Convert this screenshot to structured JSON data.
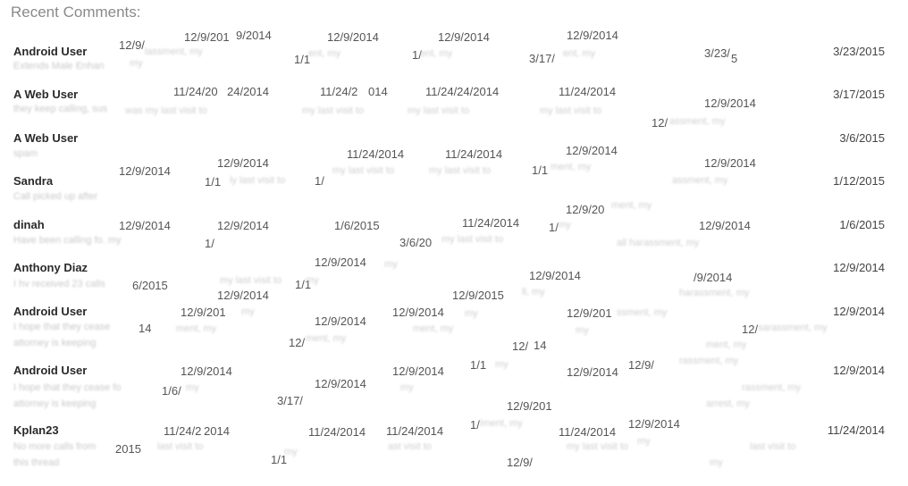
{
  "header": {
    "title": "Recent Comments:"
  },
  "comments": [
    {
      "author": "Android User",
      "preview": "Extends Male Enhan",
      "date": "3/23/2015"
    },
    {
      "author": "A Web User",
      "preview": "they keep calling, sus",
      "date": "3/17/2015"
    },
    {
      "author": "A Web User",
      "preview": "spam",
      "date": "3/6/2015"
    },
    {
      "author": "Sandra",
      "preview": "Call picked up after",
      "date": "1/12/2015"
    },
    {
      "author": "dinah",
      "preview": "Have been calling fo. my",
      "date": "1/6/2015"
    },
    {
      "author": "Anthony Diaz",
      "preview": "I hv received 23 calls",
      "date": "12/9/2014"
    },
    {
      "author": "Android User",
      "preview": "I hope that they cease",
      "preview2": "attorney is keeping",
      "date": "12/9/2014"
    },
    {
      "author": "Android User",
      "preview": "I hope that they cease fo",
      "preview2": "attorney is keeping",
      "date": "12/9/2014"
    },
    {
      "author": "Kplan23",
      "preview": "No more calls from",
      "preview2": "this thread",
      "date": "11/24/2014"
    }
  ],
  "ghosts": [
    "12/9/",
    "12/9/201",
    "9/2014",
    "12/9/2014",
    "12/9/2014",
    "12/9/2014",
    "3/23/",
    "5",
    "1/1",
    "1/",
    "3/17/",
    "11/24/20",
    "24/2014",
    "11/24/2",
    "014",
    "11/24/24/2014",
    "11/24/2014",
    "12/9/2014",
    "12/",
    "11/24/2014",
    "11/24/2014",
    "12/9/2014",
    "12/9/2014",
    "12/9/2014",
    "1/1",
    "1/",
    "1/1",
    "12/9/2014",
    "12/9/20",
    "12/9/2014",
    "12/9/2014",
    "1/6/2015",
    "11/24/2014",
    "1/",
    "12/9/2014",
    "1/",
    "3/6/20",
    "12/9/2014",
    "6/2015",
    "1/1",
    "12/9/2014",
    "/9/2014",
    "12/9/2014",
    "12/9/2015",
    "12/9/201",
    "12/9/2014",
    "12/9/2014",
    "12/9/201",
    "14",
    "12/",
    "12/",
    "12/",
    "14",
    "12/9/2014",
    "12/9/2014",
    "1/1",
    "12/9/2014",
    "12/9/",
    "1/6/",
    "12/9/2014",
    "3/17/",
    "12/9/201",
    "11/24/2",
    "2014",
    "11/24/2014",
    "11/24/2014",
    "1/",
    "11/24/2014",
    "12/9/2014",
    "2015",
    "1/1",
    "12/9/"
  ],
  "blurred": [
    "lassment, my",
    "ent, my",
    "ent, my",
    "ent, my",
    "my",
    "was my last visit to",
    "my last visit to",
    "my last visit to",
    "my last visit to",
    "assment, my",
    "my last visit to",
    "my last visit to",
    "ment, my",
    "assment, my",
    "ly last visit to",
    "ment, my",
    "my last visit to",
    "all harassment, my",
    "my",
    "my last visit to",
    "harassment, my",
    "my",
    "my",
    "ll, my",
    "ssment, my",
    "my",
    "ment, my",
    "ment, my",
    "sarassment, my",
    "ment, my",
    "my",
    "my",
    "my",
    "rassment, my",
    "ment, my",
    "my",
    "my",
    "rassment, my",
    "arrest, my",
    "last visit to",
    "ast visit to",
    "lment, my",
    "my",
    "my",
    "last visit to",
    "my last visit to",
    "my"
  ]
}
